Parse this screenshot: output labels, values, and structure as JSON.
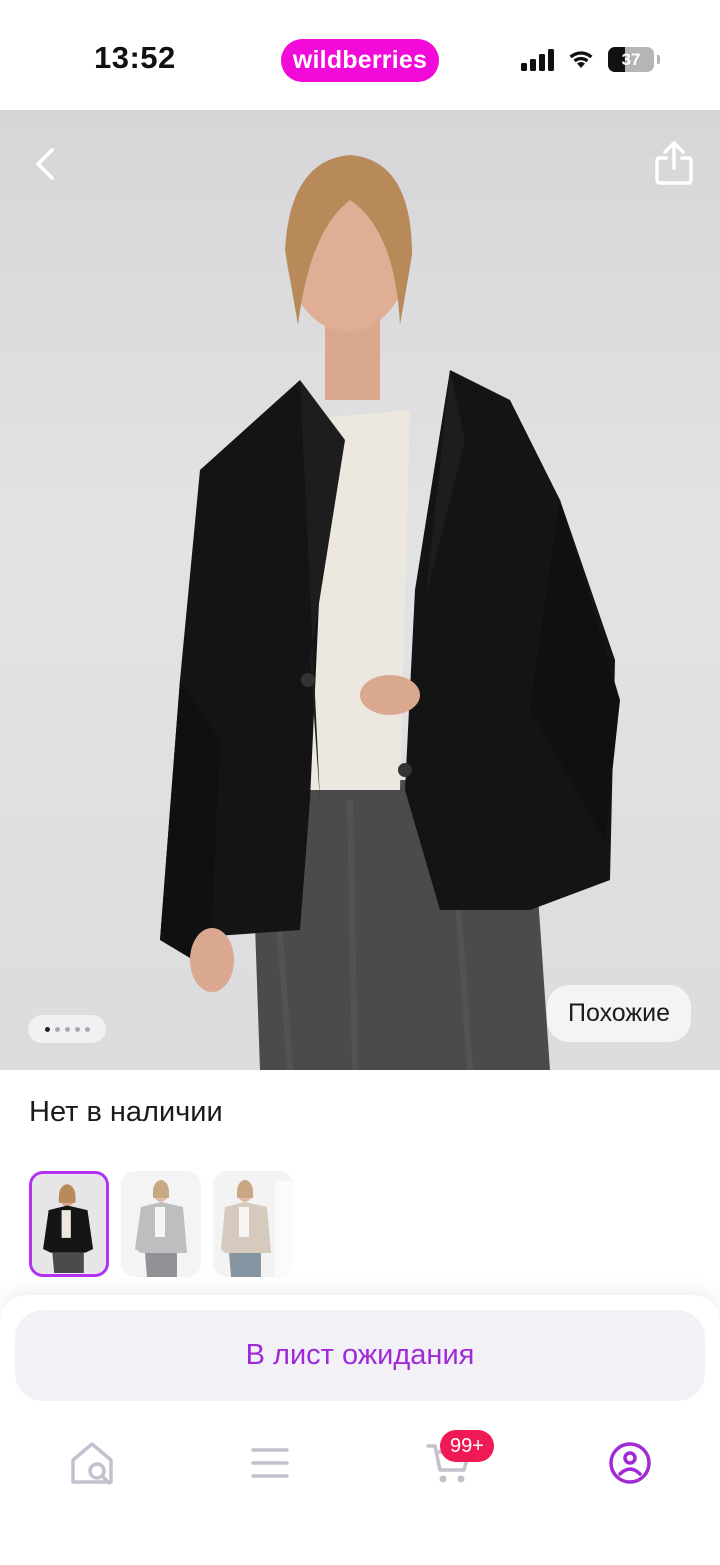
{
  "status_bar": {
    "time": "13:52",
    "brand": "wildberries",
    "battery_level": "37"
  },
  "hero": {
    "dots_total": 5,
    "dots_active": 1,
    "similar_label": "Похожие"
  },
  "product": {
    "availability": "Нет в наличии",
    "thumbnails": [
      "thumb-black-blazer",
      "thumb-grey-blazer",
      "thumb-beige-blazer"
    ]
  },
  "actions": {
    "waitlist_label": "В лист ожидания"
  },
  "tabbar": {
    "cart_badge": "99+",
    "accent_color": "#a12ad6",
    "icons": [
      "home-search-icon",
      "menu-icon",
      "cart-icon",
      "profile-icon"
    ]
  }
}
